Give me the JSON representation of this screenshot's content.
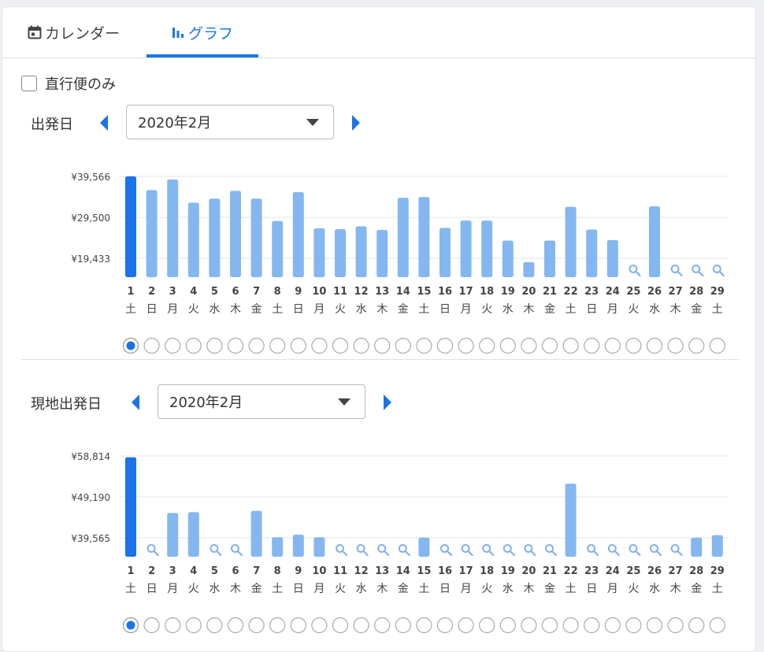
{
  "tabs": {
    "calendar_label": "カレンダー",
    "graph_label": "グラフ"
  },
  "direct_only": {
    "label": "直行便のみ",
    "checked": false
  },
  "colors": {
    "accent": "#1a73e8",
    "bar_selected": "#1a73e8",
    "bar": "#84b7f0",
    "no_data_icon": "#7fb1ee"
  },
  "outbound": {
    "label": "出発日",
    "month_value": "2020年2月",
    "chart_data": {
      "type": "bar",
      "yticks": [
        "¥39,566",
        "¥29,500",
        "¥19,433"
      ],
      "ytick_values": [
        39566,
        29500,
        19433
      ],
      "categories": [
        "1",
        "2",
        "3",
        "4",
        "5",
        "6",
        "7",
        "8",
        "9",
        "10",
        "11",
        "12",
        "13",
        "14",
        "15",
        "16",
        "17",
        "18",
        "19",
        "20",
        "21",
        "22",
        "23",
        "24",
        "25",
        "26",
        "27",
        "28",
        "29"
      ],
      "weekdays": [
        "土",
        "日",
        "月",
        "火",
        "水",
        "木",
        "金",
        "土",
        "日",
        "月",
        "火",
        "水",
        "木",
        "金",
        "土",
        "日",
        "月",
        "火",
        "水",
        "木",
        "金",
        "土",
        "日",
        "月",
        "火",
        "水",
        "木",
        "金",
        "土"
      ],
      "values": [
        39566,
        36200,
        38800,
        33100,
        34100,
        36000,
        34100,
        28600,
        35700,
        26800,
        26600,
        27300,
        26400,
        34300,
        34500,
        26900,
        28700,
        28700,
        23800,
        18500,
        23800,
        32100,
        26500,
        23900,
        null,
        32200,
        null,
        null,
        null
      ],
      "selected_index": 0
    }
  },
  "return": {
    "label": "現地出発日",
    "month_value": "2020年2月",
    "chart_data": {
      "type": "bar",
      "yticks": [
        "¥58,814",
        "¥49,190",
        "¥39,565"
      ],
      "ytick_values": [
        58814,
        49190,
        39565
      ],
      "categories": [
        "1",
        "2",
        "3",
        "4",
        "5",
        "6",
        "7",
        "8",
        "9",
        "10",
        "11",
        "12",
        "13",
        "14",
        "15",
        "16",
        "17",
        "18",
        "19",
        "20",
        "21",
        "22",
        "23",
        "24",
        "25",
        "26",
        "27",
        "28",
        "29"
      ],
      "weekdays": [
        "土",
        "日",
        "月",
        "火",
        "水",
        "木",
        "金",
        "土",
        "日",
        "月",
        "火",
        "水",
        "木",
        "金",
        "土",
        "日",
        "月",
        "火",
        "水",
        "木",
        "金",
        "土",
        "日",
        "月",
        "火",
        "水",
        "木",
        "金",
        "土"
      ],
      "values": [
        58500,
        null,
        45400,
        45600,
        null,
        null,
        45900,
        39700,
        40300,
        39700,
        null,
        null,
        null,
        null,
        39600,
        null,
        null,
        null,
        null,
        null,
        null,
        52300,
        null,
        null,
        null,
        null,
        null,
        39600,
        40200
      ],
      "selected_index": 0
    }
  }
}
